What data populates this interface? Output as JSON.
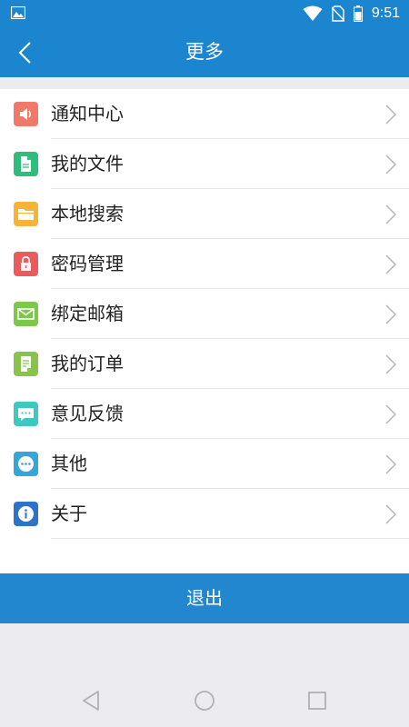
{
  "status_bar": {
    "time": "9:51"
  },
  "header": {
    "title": "更多"
  },
  "menu": {
    "items": [
      {
        "label": "通知中心",
        "icon": "speaker-icon",
        "color": "#f0796a"
      },
      {
        "label": "我的文件",
        "icon": "document-icon",
        "color": "#2dbd7c"
      },
      {
        "label": "本地搜索",
        "icon": "folder-icon",
        "color": "#f6b33a"
      },
      {
        "label": "密码管理",
        "icon": "lock-icon",
        "color": "#e85d5b"
      },
      {
        "label": "绑定邮箱",
        "icon": "mail-icon",
        "color": "#7cc84a"
      },
      {
        "label": "我的订单",
        "icon": "order-icon",
        "color": "#8ac24e"
      },
      {
        "label": "意见反馈",
        "icon": "chat-icon",
        "color": "#3fc7c0"
      },
      {
        "label": "其他",
        "icon": "more-icon",
        "color": "#36a6d8"
      },
      {
        "label": "关于",
        "icon": "info-icon",
        "color": "#2e73c8"
      }
    ]
  },
  "logout": {
    "label": "退出"
  }
}
